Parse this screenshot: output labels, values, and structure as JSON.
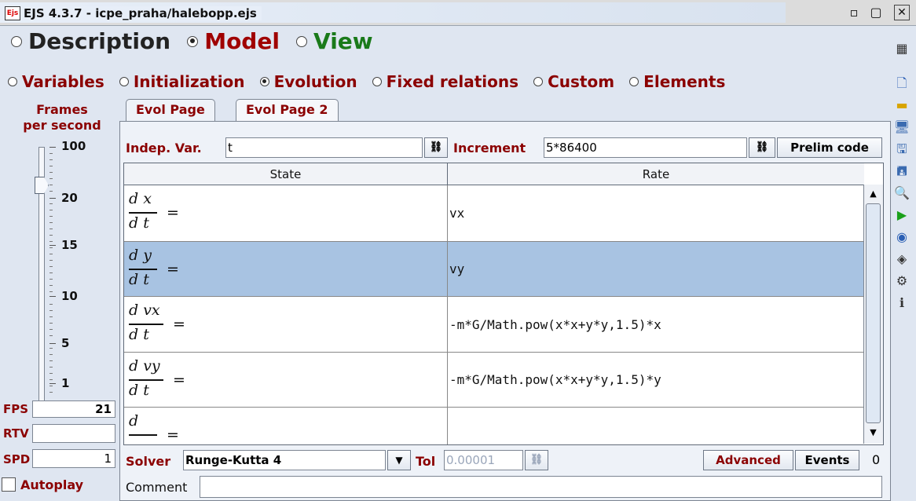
{
  "window": {
    "title": "EJS 4.3.7 - icpe_praha/halebopp.ejs",
    "app_icon": "Ejs",
    "buttons": [
      "minimize-icon",
      "maximize-icon",
      "close-icon"
    ]
  },
  "main_tabs": [
    {
      "label": "Description",
      "selected": false,
      "color": "#222222"
    },
    {
      "label": "Model",
      "selected": true,
      "color": "#a00000"
    },
    {
      "label": "View",
      "selected": false,
      "color": "#1a7a1a"
    }
  ],
  "sub_tabs": [
    {
      "label": "Variables",
      "selected": false
    },
    {
      "label": "Initialization",
      "selected": false
    },
    {
      "label": "Evolution",
      "selected": true
    },
    {
      "label": "Fixed relations",
      "selected": false
    },
    {
      "label": "Custom",
      "selected": false
    },
    {
      "label": "Elements",
      "selected": false
    }
  ],
  "left_panel": {
    "title_line1": "Frames",
    "title_line2": "per second",
    "ticks": [
      "100",
      "20",
      "15",
      "10",
      "5",
      "1"
    ],
    "slider_value": "20",
    "fps_label": "FPS",
    "fps_value": "21",
    "rtv_label": "RTV",
    "rtv_value": "",
    "spd_label": "SPD",
    "spd_value": "1",
    "autoplay_label": "Autoplay",
    "autoplay_checked": false
  },
  "evol_tabs": [
    {
      "label": "Evol Page",
      "selected": true
    },
    {
      "label": "Evol Page 2",
      "selected": false
    }
  ],
  "evolution": {
    "indep_var_label": "Indep. Var.",
    "indep_var_value": "t",
    "increment_label": "Increment",
    "increment_value": "5*86400",
    "prelim_code_label": "Prelim code",
    "state_header": "State",
    "rate_header": "Rate",
    "rows": [
      {
        "num": "d x",
        "den": "d t",
        "eq": "=",
        "rate": "vx",
        "selected": false
      },
      {
        "num": "d y",
        "den": "d t",
        "eq": "=",
        "rate": "vy",
        "selected": true
      },
      {
        "num": "d vx",
        "den": "d t",
        "eq": "=",
        "rate": "-m*G/Math.pow(x*x+y*y,1.5)*x",
        "selected": false
      },
      {
        "num": "d vy",
        "den": "d t",
        "eq": "=",
        "rate": "-m*G/Math.pow(x*x+y*y,1.5)*y",
        "selected": false
      },
      {
        "num": "d",
        "den": "",
        "eq": "=",
        "rate": "",
        "selected": false
      }
    ],
    "solver_label": "Solver",
    "solver_value": "Runge-Kutta 4",
    "tol_label": "Tol",
    "tol_value": "0.00001",
    "advanced_label": "Advanced",
    "events_label": "Events",
    "events_count": "0",
    "comment_label": "Comment",
    "comment_value": ""
  },
  "toolbar_icons": [
    "list-icon",
    "new-file-icon",
    "open-folder-icon",
    "open-web-icon",
    "save-icon",
    "save-as-icon",
    "search-icon",
    "run-icon",
    "translate-icon",
    "package-icon",
    "options-icon",
    "info-icon"
  ]
}
